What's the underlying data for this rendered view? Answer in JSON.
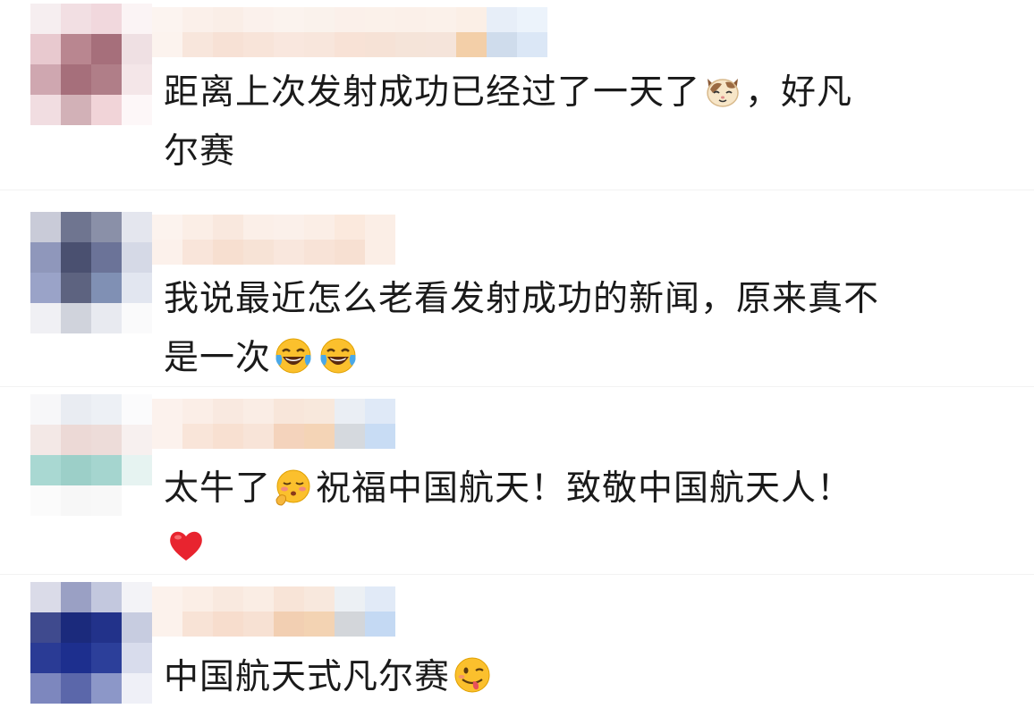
{
  "comments": [
    {
      "line1": "距离上次发射成功已经过了一天了",
      "line1_after": "，好凡",
      "line2": "尔赛",
      "emoji": "cat-face-icon"
    },
    {
      "line1": "我说最近怎么老看发射成功的新闻，原来真不",
      "line2": "是一次",
      "emoji": "tears-of-joy-icon"
    },
    {
      "line1_a": "太牛了",
      "line1_b": "祝福中国航天！致敬中国航天人！",
      "emoji1": "blushing-face-icon",
      "emoji2": "red-heart-icon"
    },
    {
      "line1": "中国航天式凡尔赛",
      "emoji": "savoring-face-icon"
    }
  ],
  "colors": {
    "text": "#1a1a1a",
    "background": "#ffffff",
    "heart": "#e8242f",
    "emoji_yellow": "#fbc02d"
  }
}
